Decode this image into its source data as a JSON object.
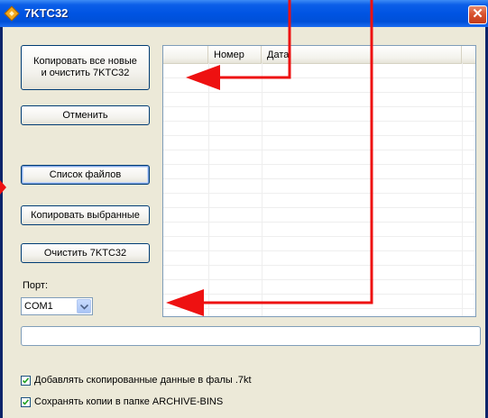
{
  "window": {
    "title": "7KTC32"
  },
  "buttons": {
    "copy_all": "Копировать все новые\nи очистить 7KTC32",
    "cancel": "Отменить",
    "file_list": "Список файлов",
    "copy_selected": "Копировать выбранные",
    "clear": "Очистить 7KTC32"
  },
  "list": {
    "columns": [
      "",
      "Номер",
      "Дата",
      ""
    ]
  },
  "port": {
    "label": "Порт:",
    "value": "COM1"
  },
  "options": {
    "append_7kt": {
      "label": "Добавлять скопированные данные в фалы .7kt",
      "checked": true
    },
    "save_archive": {
      "label": "Сохранять копии в папке ARCHIVE-BINS",
      "checked": true
    }
  },
  "colors": {
    "annotation_arrow": "#ee1111",
    "title_bar": "#0054e3",
    "face": "#ece9d8"
  }
}
